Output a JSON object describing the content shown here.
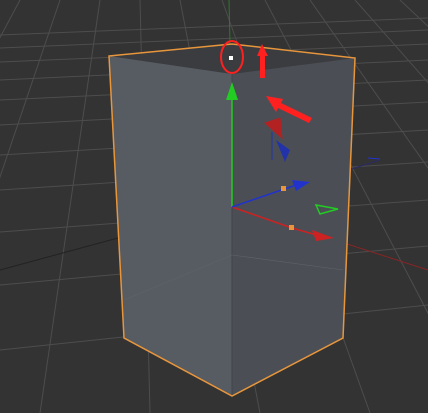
{
  "viewport": {
    "kind": "3D perspective viewport",
    "background_color": "#333333",
    "grid_color": "#4a4a4a",
    "selection_outline_color": "#e8963c"
  },
  "object": {
    "shape": "box",
    "selected": true,
    "face_colors": {
      "top": "#3a3c40",
      "front": "#55595f",
      "side": "#4a4e54"
    }
  },
  "axes": {
    "x_color": "#cc2222",
    "y_color": "#22cc22",
    "z_color": "#2233cc"
  },
  "annotations": {
    "highlight_color": "#ff2020",
    "circle_target": "top-vertex-point",
    "arrows": [
      "up-arrow",
      "diagonal-arrow"
    ]
  },
  "icons": [
    "move-gizmo-icon",
    "rotate-handle-icon",
    "scale-handle-icon"
  ]
}
